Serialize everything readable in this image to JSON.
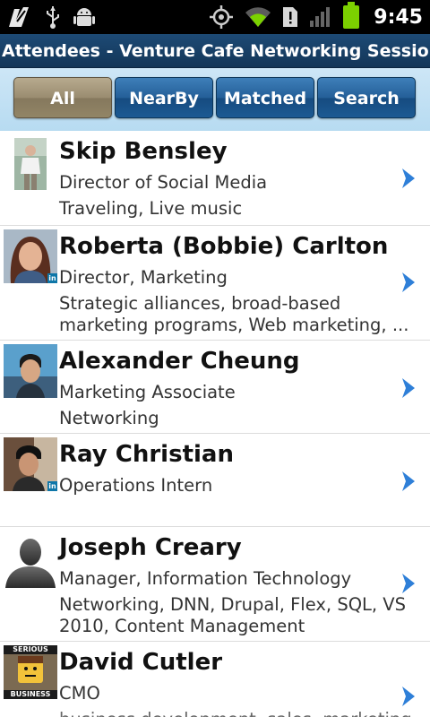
{
  "status_bar": {
    "time": "9:45",
    "icons": [
      "usb-debug-icon",
      "usb-icon",
      "android-icon",
      "gps-icon",
      "wifi-icon",
      "sim-alert-icon",
      "signal-icon",
      "battery-icon"
    ]
  },
  "app": {
    "title": "Attendees - Venture Cafe Networking Session ..."
  },
  "tabs": [
    {
      "label": "All",
      "active": true
    },
    {
      "label": "NearBy",
      "active": false
    },
    {
      "label": "Matched",
      "active": false
    },
    {
      "label": "Search",
      "active": false
    }
  ],
  "attendees": [
    {
      "name": "Skip Bensley",
      "title": "Director of Social Media",
      "interests": [
        "Traveling, Live music"
      ],
      "linkedin": false,
      "badge": ""
    },
    {
      "name": "Roberta (Bobbie) Carlton",
      "title": "Director, Marketing",
      "interests": [
        "Strategic alliances, broad-based",
        "marketing programs, Web marketing, ..."
      ],
      "linkedin": true,
      "badge": "in"
    },
    {
      "name": "Alexander Cheung",
      "title": "Marketing Associate",
      "interests": [
        "Networking"
      ],
      "linkedin": false,
      "badge": ""
    },
    {
      "name": "Ray Christian",
      "title": "Operations Intern",
      "interests": [],
      "linkedin": true,
      "badge": "in"
    },
    {
      "name": "Joseph Creary",
      "title": "Manager, Information Technology",
      "interests": [
        "Networking, DNN, Drupal, Flex, SQL, VS",
        "2010, Content Management"
      ],
      "linkedin": false,
      "badge": ""
    },
    {
      "name": "David  Cutler",
      "title": "CMO",
      "interests": [
        "business development, sales, marketing"
      ],
      "linkedin": false,
      "badge": "",
      "avatar_text": [
        "SERIOUS",
        "BUSINESS"
      ]
    }
  ],
  "colors": {
    "title_bar": "#1a4470",
    "tab_blue": "#245f98",
    "tab_active": "#9a8c70",
    "chevron": "#2e7fd8",
    "battery": "#7cd000"
  }
}
